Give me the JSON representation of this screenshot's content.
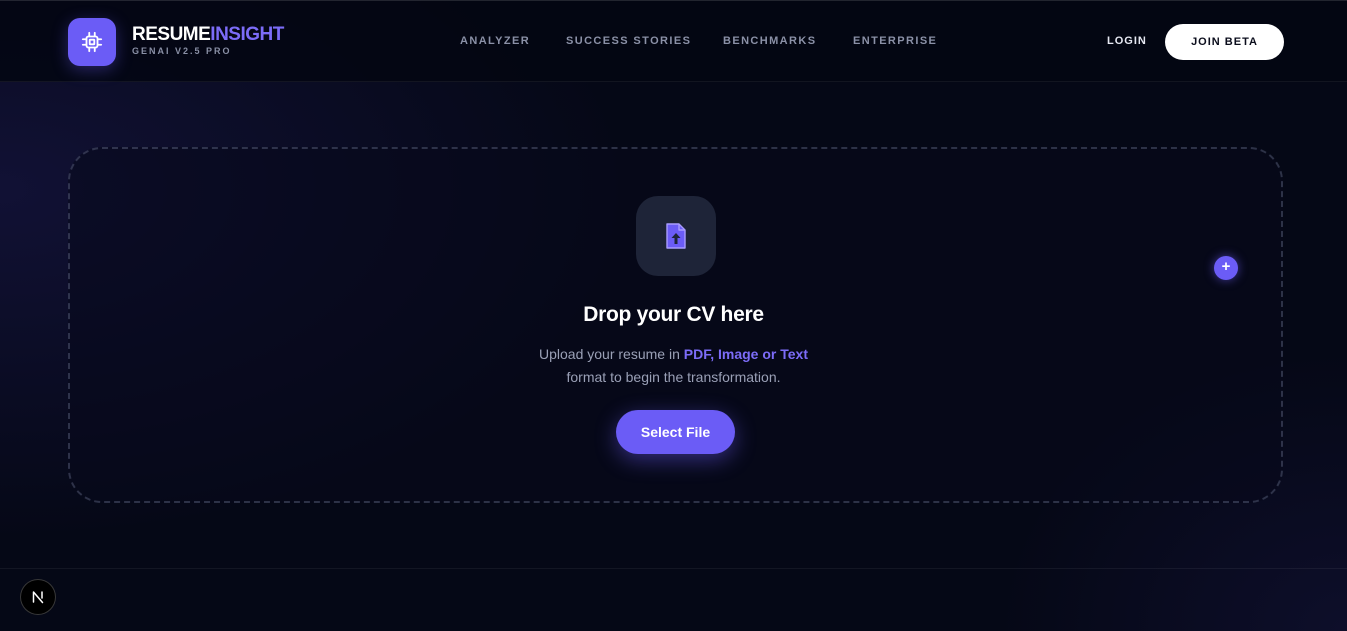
{
  "brand": {
    "name_part1": "RESUME",
    "name_part2": "INSIGHT",
    "subtitle": "GENAI V2.5 PRO",
    "logo_icon": "chip-icon",
    "accent_color": "#6b5cf6"
  },
  "nav": {
    "items": [
      {
        "label": "ANALYZER"
      },
      {
        "label": "SUCCESS STORIES"
      },
      {
        "label": "BENCHMARKS"
      },
      {
        "label": "ENTERPRISE"
      }
    ],
    "login_label": "LOGIN",
    "join_label": "JOIN BETA"
  },
  "upload": {
    "icon": "file-upload-icon",
    "title": "Drop your CV here",
    "desc_prefix": "Upload your resume in ",
    "desc_highlight": "PDF, Image or Text",
    "desc_suffix": "format to begin the transformation.",
    "button_label": "Select File",
    "add_icon": "plus-icon"
  },
  "footer": {
    "badge_icon": "n-logo-icon"
  }
}
